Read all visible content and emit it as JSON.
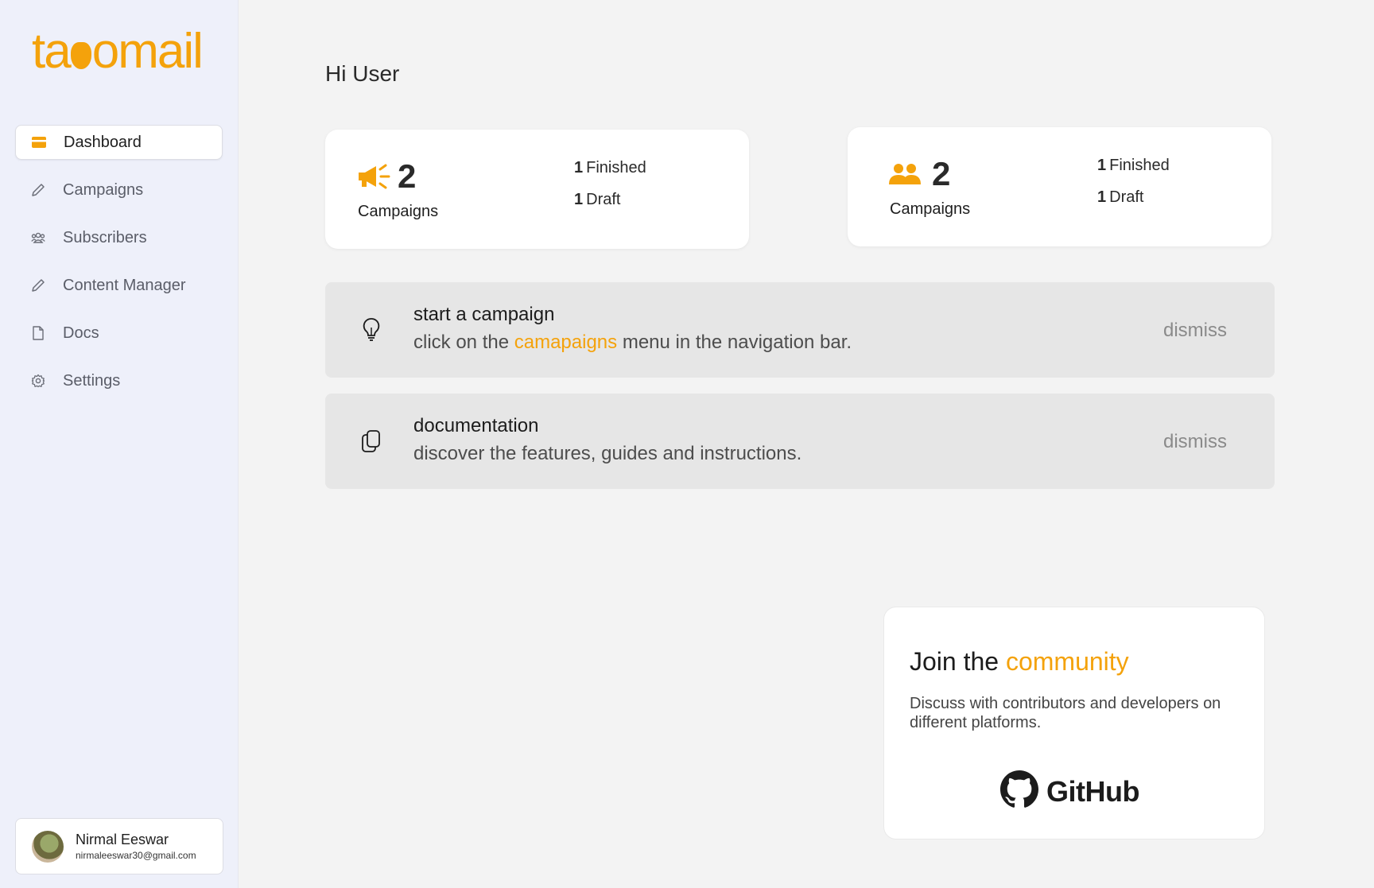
{
  "brand": {
    "name": "tacomail",
    "color": "#f4a20b"
  },
  "sidebar": {
    "items": [
      {
        "label": "Dashboard",
        "icon": "card-icon"
      },
      {
        "label": "Campaigns",
        "icon": "pencil-icon"
      },
      {
        "label": "Subscribers",
        "icon": "users-icon"
      },
      {
        "label": "Content Manager",
        "icon": "pencil-icon"
      },
      {
        "label": "Docs",
        "icon": "document-icon"
      },
      {
        "label": "Settings",
        "icon": "gear-icon"
      }
    ],
    "active": "Dashboard",
    "user": {
      "name": "Nirmal Eeswar",
      "email": "nirmaleeswar30@gmail.com"
    }
  },
  "main": {
    "greeting": "Hi User",
    "stats": [
      {
        "icon": "megaphone-icon",
        "count": "2",
        "label": "Campaigns",
        "finished_count": "1",
        "finished_label": "Finished",
        "draft_count": "1",
        "draft_label": "Draft"
      },
      {
        "icon": "users-icon",
        "count": "2",
        "label": "Campaigns",
        "finished_count": "1",
        "finished_label": "Finished",
        "draft_count": "1",
        "draft_label": "Draft"
      }
    ],
    "tips": [
      {
        "icon": "lightbulb-icon",
        "title": "start a campaign",
        "text_before": "click on the ",
        "highlight": "camapaigns",
        "text_after": " menu in the navigation bar.",
        "dismiss": "dismiss"
      },
      {
        "icon": "copy-icon",
        "title": "documentation",
        "text": "discover the features, guides and instructions.",
        "dismiss": "dismiss"
      }
    ],
    "community": {
      "title_plain": "Join the ",
      "title_highlight": "community",
      "description": "Discuss with contributors and developers on different platforms.",
      "github_label": "GitHub"
    }
  }
}
